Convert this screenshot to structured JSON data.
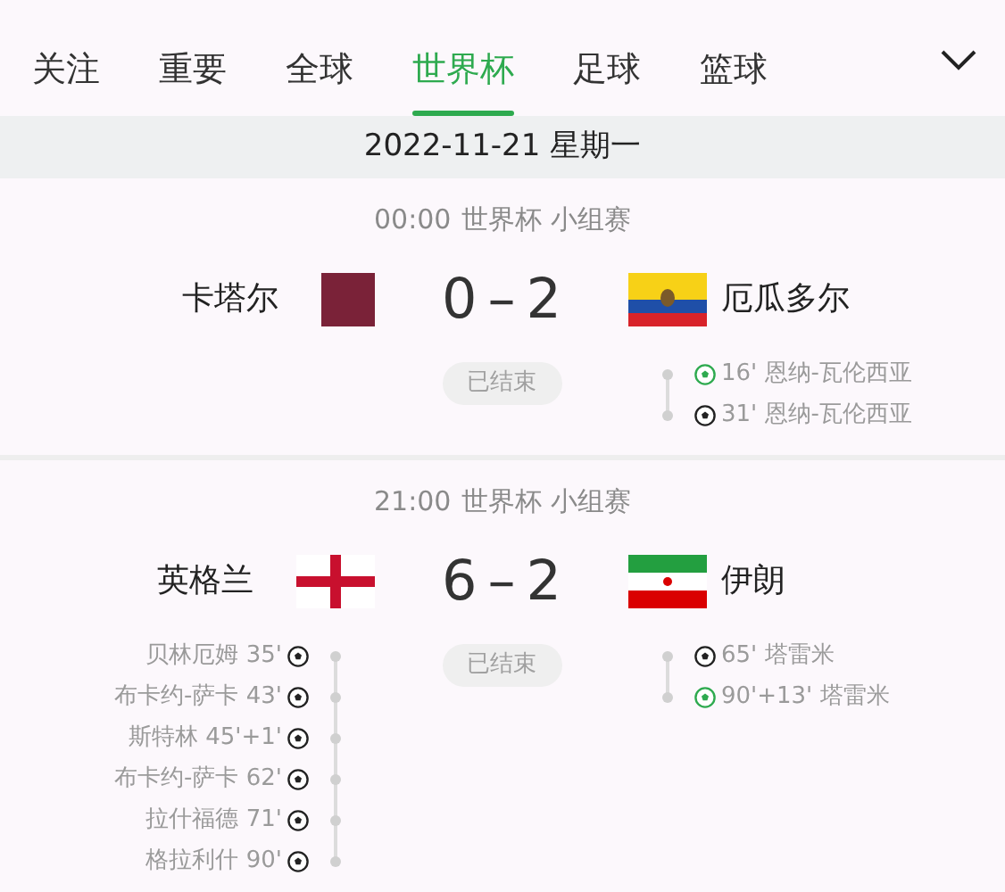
{
  "tabs": [
    {
      "label": "关注",
      "selected": false
    },
    {
      "label": "重要",
      "selected": false
    },
    {
      "label": "全球",
      "selected": false
    },
    {
      "label": "世界杯",
      "selected": true
    },
    {
      "label": "足球",
      "selected": false
    },
    {
      "label": "篮球",
      "selected": false
    }
  ],
  "date": "2022-11-21 星期一",
  "matches": [
    {
      "time": "00:00",
      "competition": "世界杯 小组赛",
      "home": {
        "name": "卡塔尔",
        "kind": "qatar",
        "score": "0"
      },
      "separator": "–",
      "away": {
        "name": "厄瓜多尔",
        "kind": "ecuador",
        "score": "2"
      },
      "status": "已结束",
      "away_events": [
        {
          "minute": "16'",
          "player": "恩纳-瓦伦西亚",
          "kind": "penalty"
        },
        {
          "minute": "31'",
          "player": "恩纳-瓦伦西亚",
          "kind": "goal"
        }
      ]
    },
    {
      "time": "21:00",
      "competition": "世界杯 小组赛",
      "home": {
        "name": "英格兰",
        "kind": "england",
        "score": "6"
      },
      "separator": "–",
      "away": {
        "name": "伊朗",
        "kind": "iran",
        "score": "2"
      },
      "status": "已结束",
      "home_events": [
        {
          "minute": "35'",
          "player": "贝林厄姆",
          "kind": "goal"
        },
        {
          "minute": "43'",
          "player": "布卡约-萨卡",
          "kind": "goal"
        },
        {
          "minute": "45'+1'",
          "player": "斯特林",
          "kind": "goal"
        },
        {
          "minute": "62'",
          "player": "布卡约-萨卡",
          "kind": "goal"
        },
        {
          "minute": "71'",
          "player": "拉什福德",
          "kind": "goal"
        },
        {
          "minute": "90'",
          "player": "格拉利什",
          "kind": "goal"
        }
      ],
      "away_events": [
        {
          "minute": "65'",
          "player": "塔雷米",
          "kind": "goal"
        },
        {
          "minute": "90'+13'",
          "player": "塔雷米",
          "kind": "penalty"
        }
      ]
    }
  ]
}
